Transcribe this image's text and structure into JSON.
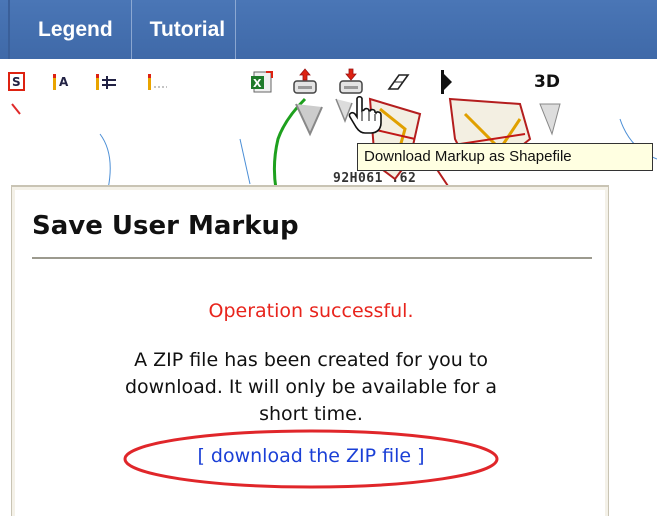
{
  "menubar": {
    "items": [
      {
        "label": "Legend"
      },
      {
        "label": "Tutorial"
      }
    ],
    "background_color": "#4a76b6"
  },
  "toolbar": {
    "tools": [
      {
        "icon": "identify-layer-icon"
      },
      {
        "icon": "text-label-icon",
        "text": "A"
      },
      {
        "icon": "measure-icon"
      },
      {
        "icon": "line-draw-icon"
      },
      {
        "icon": "excel-export-icon"
      },
      {
        "icon": "upload-markup-icon"
      },
      {
        "icon": "download-markup-icon"
      },
      {
        "icon": "eraser-icon"
      },
      {
        "icon": "play-icon"
      }
    ],
    "three_d_label": "3D"
  },
  "map": {
    "grid_label": "92H061 .62"
  },
  "tooltip": {
    "text": "Download Markup as Shapefile"
  },
  "dialog": {
    "title": "Save User Markup",
    "status": "Operation successful.",
    "status_color": "#e8241c",
    "info_lines": [
      "A ZIP file has been created for you to",
      "download. It will only be available for a",
      "short time."
    ],
    "download_link": "[ download the ZIP file ]",
    "link_color": "#1a3fd6",
    "highlight_color": "#e0262a"
  }
}
